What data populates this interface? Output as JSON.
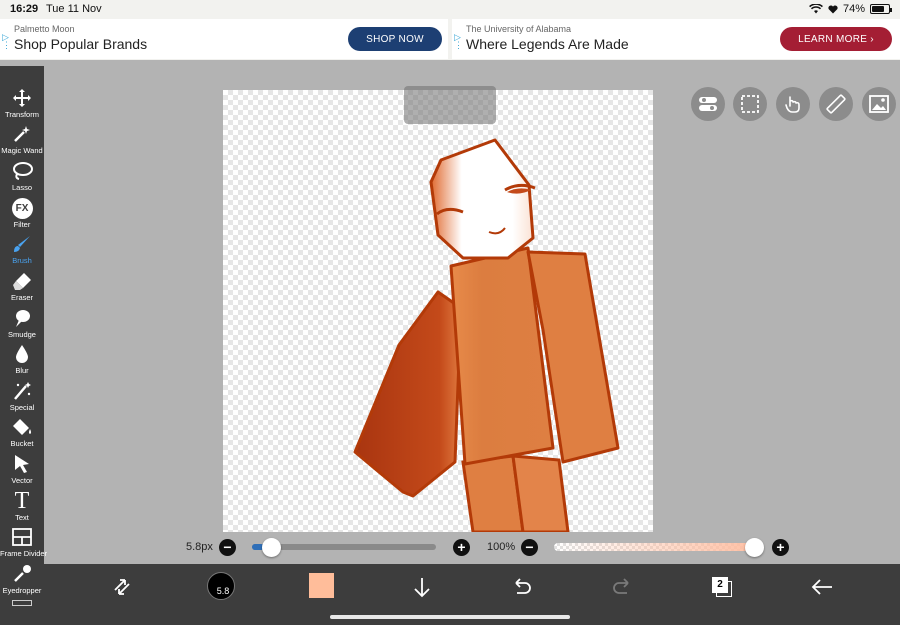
{
  "status": {
    "time": "16:29",
    "date": "Tue 11 Nov",
    "battery": "74%"
  },
  "ads": [
    {
      "sponsor": "Palmetto Moon",
      "headline": "Shop Popular Brands",
      "cta": "SHOP NOW"
    },
    {
      "sponsor": "The University of Alabama",
      "headline": "Where Legends Are Made",
      "cta": "LEARN MORE"
    }
  ],
  "tools": [
    {
      "label": "Transform",
      "icon": "move-arrows-icon"
    },
    {
      "label": "Magic Wand",
      "icon": "magic-wand-icon"
    },
    {
      "label": "Lasso",
      "icon": "lasso-icon"
    },
    {
      "label": "Filter",
      "icon": "fx-icon"
    },
    {
      "label": "Brush",
      "icon": "brush-icon"
    },
    {
      "label": "Eraser",
      "icon": "eraser-icon"
    },
    {
      "label": "Smudge",
      "icon": "smudge-icon"
    },
    {
      "label": "Blur",
      "icon": "droplet-icon"
    },
    {
      "label": "Special",
      "icon": "sparkle-wand-icon"
    },
    {
      "label": "Bucket",
      "icon": "bucket-icon"
    },
    {
      "label": "Vector",
      "icon": "cursor-arrow-icon"
    },
    {
      "label": "Text",
      "icon": "text-icon"
    },
    {
      "label": "Frame Divider",
      "icon": "frame-divider-icon"
    },
    {
      "label": "Eyedropper",
      "icon": "eyedropper-icon"
    }
  ],
  "filter_icon_text": "FX",
  "text_icon_text": "T",
  "brush_size": {
    "value": "5.8px",
    "fraction": 0.1
  },
  "opacity": {
    "value": "100%",
    "fraction": 1.0
  },
  "brush_preview_value": "5.8",
  "current_color": "#ffbd9a",
  "accent_color": "#4aa3f0",
  "layer_count": "2"
}
